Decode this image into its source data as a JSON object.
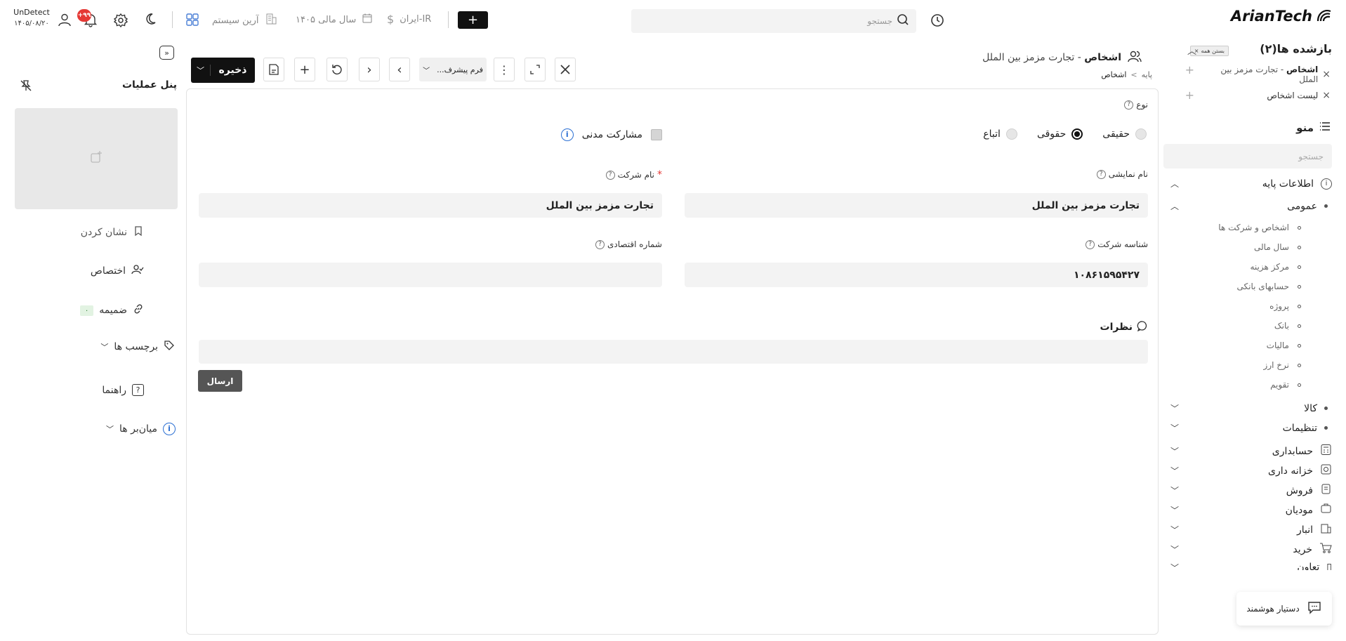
{
  "header": {
    "logo": "ArianTech",
    "search_placeholder": "جستجو",
    "add_label": "+",
    "region": "ایران-IR",
    "fiscal_year": "سال مالی ۱۴۰۵",
    "company": "آرین سیستم",
    "notif_badge": "+۹۹",
    "user_name": "UnDetect",
    "user_date": "۱۴۰۵/۰۸/۲۰"
  },
  "sidebar": {
    "opened_title": "بازشده ها(۲)",
    "close_all": "بستن همه",
    "opened_items": [
      {
        "bold": "اشخاص",
        "rest": " - تجارت مزمز بین الملل"
      },
      {
        "bold": "",
        "rest": "لیست اشخاص"
      }
    ],
    "menu_title": "منو",
    "menu_search_placeholder": "جستجو",
    "menu": {
      "base_info": "اطلاعات پایه",
      "general": "عمومی",
      "general_items": [
        "اشخاص و شرکت ها",
        "سال مالی",
        "مرکز هزینه",
        "حسابهای بانکی",
        "پروژه",
        "بانک",
        "مالیات",
        "نرخ ارز",
        "تقویم"
      ],
      "goods": "کالا",
      "settings": "تنظیمات",
      "accounting": "حسابداری",
      "treasury": "خزانه داری",
      "sales": "فروش",
      "taxpayers": "مودیان",
      "warehouse": "انبار",
      "purchase": "خرید",
      "cut": "تعاون"
    },
    "assistant": "دستیار هوشمند"
  },
  "form": {
    "title_bold": "اشخاص",
    "title_rest": " - تجارت مزمز بین الملل",
    "breadcrumb_root": "پایه",
    "breadcrumb_sep": ">",
    "breadcrumb_current": "اشخاص",
    "save_label": "ذخیره",
    "form_select": "فرم پیشرف...",
    "type_label": "نوع",
    "type_options": [
      "حقیقی",
      "حقوقی",
      "اتباع"
    ],
    "type_selected": "حقوقی",
    "civil_partnership": "مشارکت مدنی",
    "display_name_label": "نام نمایشی",
    "display_name_value": "تجارت مزمز بین الملل",
    "company_name_label": "نام شرکت",
    "company_name_value": "تجارت مزمز بین الملل",
    "required_mark": "*",
    "company_id_label": "شناسه شرکت",
    "company_id_value": "۱۰۸۶۱۵۹۵۴۲۷",
    "economic_no_label": "شماره اقتصادی",
    "economic_no_value": "",
    "comments_label": "نظرات",
    "send_label": "ارسال"
  },
  "ops_panel": {
    "title": "پنل عملیات",
    "bookmark": "نشان کردن",
    "assign": "اختصاص",
    "attachment": "ضمیمه",
    "attachment_count": "۰",
    "tags": "برچسب ها",
    "help": "راهنما",
    "shortcuts": "میان‌بر ها"
  }
}
